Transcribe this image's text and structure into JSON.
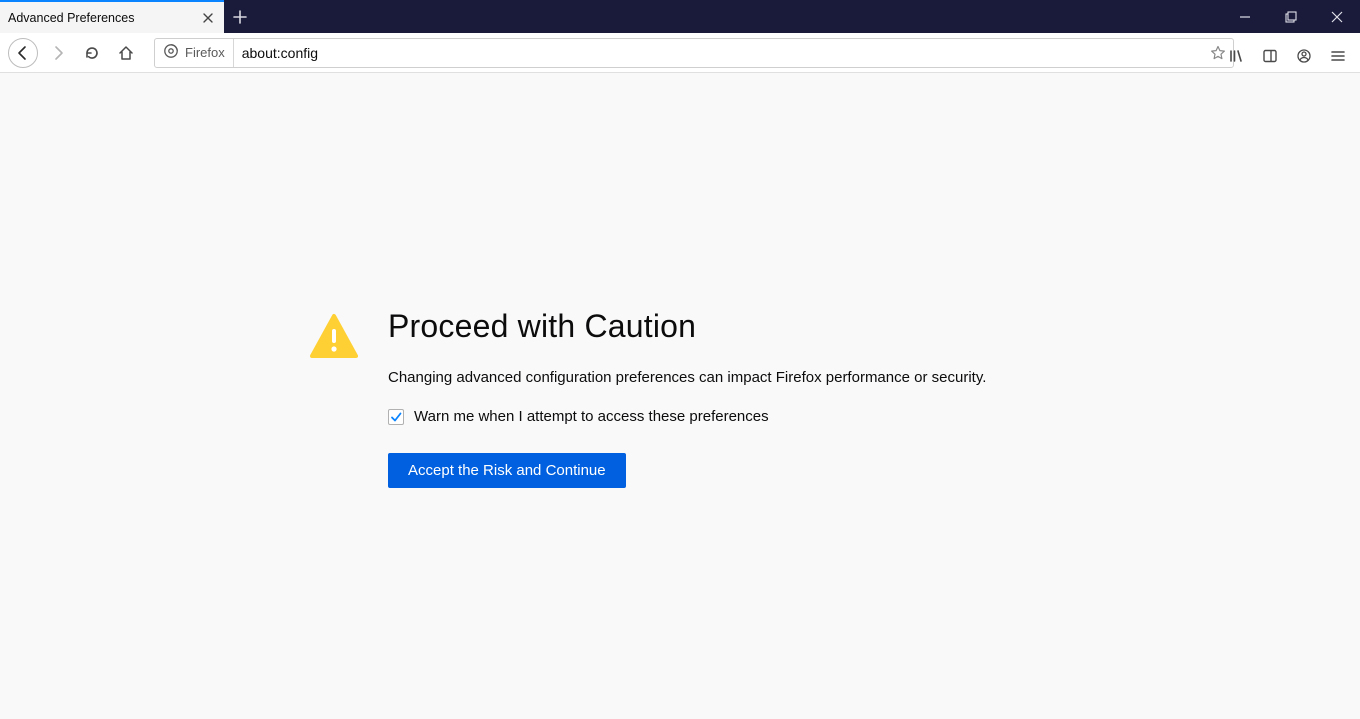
{
  "tab": {
    "title": "Advanced Preferences"
  },
  "urlbar": {
    "identity_label": "Firefox",
    "url": "about:config"
  },
  "warning": {
    "title": "Proceed with Caution",
    "description": "Changing advanced configuration preferences can impact Firefox performance or security.",
    "checkbox_label": "Warn me when I attempt to access these preferences",
    "checkbox_checked": true,
    "accept_button": "Accept the Risk and Continue"
  }
}
